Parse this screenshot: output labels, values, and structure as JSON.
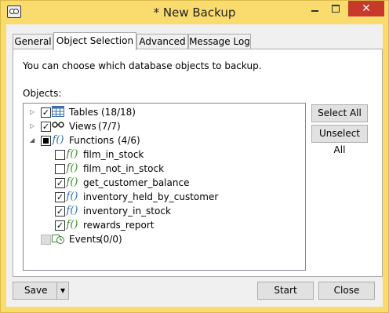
{
  "window": {
    "title": "* New Backup"
  },
  "tabs": [
    {
      "label": "General"
    },
    {
      "label": "Object Selection"
    },
    {
      "label": "Advanced"
    },
    {
      "label": "Message Log"
    }
  ],
  "panel": {
    "description": "You can choose which database objects to backup.",
    "objects_label": "Objects:"
  },
  "tree": [
    {
      "label": "Tables",
      "count": "(18/18)",
      "icon": "table-icon"
    },
    {
      "label": "Views",
      "count": "(7/7)",
      "icon": "glasses-icon"
    },
    {
      "label": "Functions",
      "count": "(4/6)",
      "icon": "function-icon"
    },
    {
      "label": "film_in_stock",
      "checked": false
    },
    {
      "label": "film_not_in_stock",
      "checked": false
    },
    {
      "label": "get_customer_balance",
      "checked": true
    },
    {
      "label": "inventory_held_by_customer",
      "checked": true
    },
    {
      "label": "inventory_in_stock",
      "checked": true
    },
    {
      "label": "rewards_report",
      "checked": true
    },
    {
      "label": "Events",
      "count": "(0/0)",
      "icon": "event-clock-icon"
    }
  ],
  "buttons": {
    "select_all": "Select All",
    "unselect_all": "Unselect All",
    "save": "Save",
    "start": "Start",
    "close": "Close"
  },
  "colors": {
    "titlebar": "#fadb6e",
    "close": "#c7392b"
  }
}
